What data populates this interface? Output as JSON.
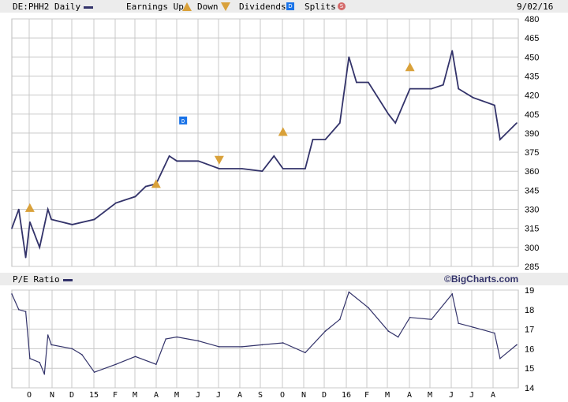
{
  "header": {
    "symbol_label": "DE:PHH2 Daily",
    "earnings_label": "Earnings Up",
    "down_label": "Down",
    "dividends_label": "Dividends",
    "splits_label": "Splits",
    "date": "9/02/16",
    "earnings_up_icon": "E",
    "earnings_down_icon": "E",
    "dividend_icon": "D",
    "split_icon": "S"
  },
  "pe_header": {
    "label": "P/E Ratio",
    "brand": "©BigCharts.com"
  },
  "colors": {
    "series": "#33336a",
    "earnings": "#d9a13a",
    "dividend": "#1a73e8",
    "split": "#d46a6a",
    "grid": "#c8c8c8"
  },
  "chart_data": [
    {
      "type": "line",
      "title": "DE:PHH2 Daily",
      "ylim": [
        285,
        480
      ],
      "yticks": [
        285,
        300,
        315,
        330,
        345,
        360,
        375,
        390,
        405,
        420,
        435,
        450,
        465,
        480
      ],
      "xticks": [
        "O",
        "N",
        "D",
        "15",
        "F",
        "M",
        "A",
        "M",
        "J",
        "J",
        "A",
        "S",
        "O",
        "N",
        "D",
        "16",
        "F",
        "M",
        "A",
        "M",
        "J",
        "J",
        "A"
      ],
      "grid": true,
      "x": [
        "2014-09-05",
        "2014-09-15",
        "2014-09-25",
        "2014-10-01",
        "2014-10-15",
        "2014-10-27",
        "2014-11-01",
        "2014-12-01",
        "2015-01-02",
        "2015-02-02",
        "2015-03-02",
        "2015-03-17",
        "2015-04-01",
        "2015-04-20",
        "2015-05-01",
        "2015-06-01",
        "2015-07-01",
        "2015-08-03",
        "2015-09-01",
        "2015-09-18",
        "2015-10-01",
        "2015-11-02",
        "2015-11-13",
        "2015-12-01",
        "2015-12-22",
        "2016-01-04",
        "2016-01-15",
        "2016-02-01",
        "2016-03-01",
        "2016-03-11",
        "2016-04-01",
        "2016-05-02",
        "2016-05-19",
        "2016-06-01",
        "2016-06-10",
        "2016-07-01",
        "2016-08-01",
        "2016-08-09",
        "2016-09-02"
      ],
      "values": [
        315,
        330,
        292,
        320,
        300,
        330,
        322,
        318,
        322,
        335,
        340,
        348,
        350,
        372,
        368,
        368,
        362,
        362,
        360,
        372,
        362,
        362,
        385,
        385,
        398,
        450,
        430,
        430,
        405,
        398,
        425,
        425,
        428,
        455,
        425,
        418,
        412,
        385,
        398
      ],
      "earnings_up": [
        {
          "date": "2014-10-01",
          "value": 331
        },
        {
          "date": "2015-04-01",
          "value": 350
        },
        {
          "date": "2015-10-01",
          "value": 391
        },
        {
          "date": "2016-04-01",
          "value": 442
        }
      ],
      "earnings_down": [
        {
          "date": "2015-07-01",
          "value": 369
        }
      ],
      "dividends": [
        {
          "date": "2015-05-10",
          "value": 400
        }
      ]
    },
    {
      "type": "line",
      "title": "P/E Ratio",
      "ylim": [
        14,
        19
      ],
      "yticks": [
        14,
        15,
        16,
        17,
        18,
        19
      ],
      "xticks": [
        "O",
        "N",
        "D",
        "15",
        "F",
        "M",
        "A",
        "M",
        "J",
        "J",
        "A",
        "S",
        "O",
        "N",
        "D",
        "16",
        "F",
        "M",
        "A",
        "M",
        "J",
        "J",
        "A"
      ],
      "grid": true,
      "x": [
        "2014-09-05",
        "2014-09-15",
        "2014-09-25",
        "2014-10-01",
        "2014-10-15",
        "2014-10-22",
        "2014-10-27",
        "2014-11-01",
        "2014-12-01",
        "2014-12-15",
        "2015-01-02",
        "2015-02-02",
        "2015-03-02",
        "2015-04-01",
        "2015-04-15",
        "2015-05-01",
        "2015-06-01",
        "2015-07-01",
        "2015-08-03",
        "2015-09-01",
        "2015-10-01",
        "2015-11-02",
        "2015-12-01",
        "2015-12-22",
        "2016-01-04",
        "2016-02-01",
        "2016-03-01",
        "2016-03-15",
        "2016-04-01",
        "2016-05-02",
        "2016-06-01",
        "2016-06-10",
        "2016-07-01",
        "2016-08-01",
        "2016-08-09",
        "2016-09-02"
      ],
      "values": [
        18.8,
        18.0,
        17.9,
        15.5,
        15.3,
        14.7,
        16.7,
        16.2,
        16.0,
        15.7,
        14.8,
        15.2,
        15.6,
        15.2,
        16.5,
        16.6,
        16.4,
        16.1,
        16.1,
        16.2,
        16.3,
        15.8,
        16.9,
        17.5,
        18.9,
        18.1,
        16.9,
        16.6,
        17.6,
        17.5,
        18.8,
        17.3,
        17.1,
        16.8,
        15.5,
        16.2
      ]
    }
  ]
}
